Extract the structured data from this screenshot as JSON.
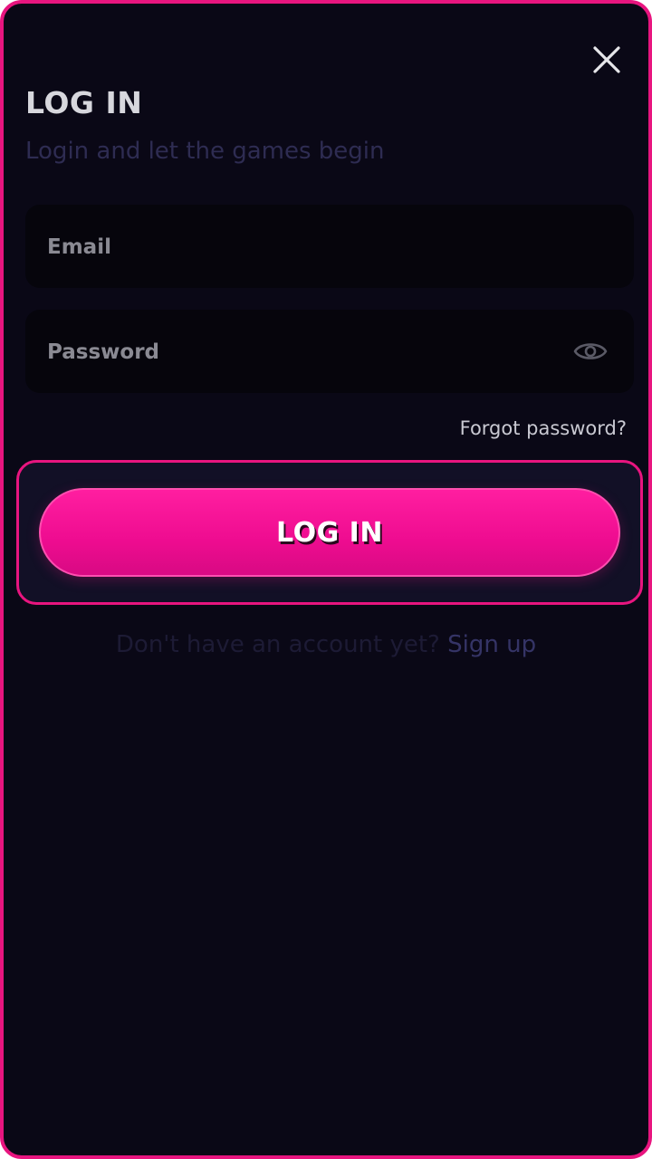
{
  "modal": {
    "title": "LOG IN",
    "subtitle": "Login and let the games begin"
  },
  "email": {
    "placeholder": "Email",
    "value": ""
  },
  "password": {
    "placeholder": "Password",
    "value": ""
  },
  "forgot_password_label": "Forgot password?",
  "login_button_label": "LOG IN",
  "signup": {
    "prompt": "Don't have an account yet?",
    "link_label": "Sign up"
  },
  "icons": {
    "close": "close-icon",
    "show_password": "eye-icon"
  },
  "colors": {
    "accent": "#e8157f",
    "background": "#0a0816",
    "field_background": "#06050c"
  }
}
